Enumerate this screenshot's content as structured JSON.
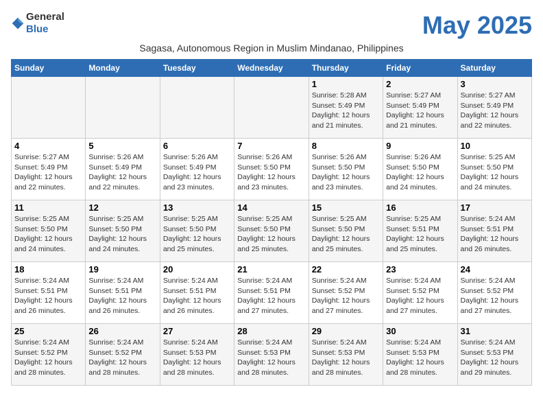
{
  "header": {
    "logo_general": "General",
    "logo_blue": "Blue",
    "month_title": "May 2025",
    "subtitle": "Sagasa, Autonomous Region in Muslim Mindanao, Philippines"
  },
  "days_of_week": [
    "Sunday",
    "Monday",
    "Tuesday",
    "Wednesday",
    "Thursday",
    "Friday",
    "Saturday"
  ],
  "weeks": [
    [
      {
        "day": "",
        "sunrise": "",
        "sunset": "",
        "daylight": ""
      },
      {
        "day": "",
        "sunrise": "",
        "sunset": "",
        "daylight": ""
      },
      {
        "day": "",
        "sunrise": "",
        "sunset": "",
        "daylight": ""
      },
      {
        "day": "",
        "sunrise": "",
        "sunset": "",
        "daylight": ""
      },
      {
        "day": "1",
        "sunrise": "Sunrise: 5:28 AM",
        "sunset": "Sunset: 5:49 PM",
        "daylight": "Daylight: 12 hours and 21 minutes."
      },
      {
        "day": "2",
        "sunrise": "Sunrise: 5:27 AM",
        "sunset": "Sunset: 5:49 PM",
        "daylight": "Daylight: 12 hours and 21 minutes."
      },
      {
        "day": "3",
        "sunrise": "Sunrise: 5:27 AM",
        "sunset": "Sunset: 5:49 PM",
        "daylight": "Daylight: 12 hours and 22 minutes."
      }
    ],
    [
      {
        "day": "4",
        "sunrise": "Sunrise: 5:27 AM",
        "sunset": "Sunset: 5:49 PM",
        "daylight": "Daylight: 12 hours and 22 minutes."
      },
      {
        "day": "5",
        "sunrise": "Sunrise: 5:26 AM",
        "sunset": "Sunset: 5:49 PM",
        "daylight": "Daylight: 12 hours and 22 minutes."
      },
      {
        "day": "6",
        "sunrise": "Sunrise: 5:26 AM",
        "sunset": "Sunset: 5:49 PM",
        "daylight": "Daylight: 12 hours and 23 minutes."
      },
      {
        "day": "7",
        "sunrise": "Sunrise: 5:26 AM",
        "sunset": "Sunset: 5:50 PM",
        "daylight": "Daylight: 12 hours and 23 minutes."
      },
      {
        "day": "8",
        "sunrise": "Sunrise: 5:26 AM",
        "sunset": "Sunset: 5:50 PM",
        "daylight": "Daylight: 12 hours and 23 minutes."
      },
      {
        "day": "9",
        "sunrise": "Sunrise: 5:26 AM",
        "sunset": "Sunset: 5:50 PM",
        "daylight": "Daylight: 12 hours and 24 minutes."
      },
      {
        "day": "10",
        "sunrise": "Sunrise: 5:25 AM",
        "sunset": "Sunset: 5:50 PM",
        "daylight": "Daylight: 12 hours and 24 minutes."
      }
    ],
    [
      {
        "day": "11",
        "sunrise": "Sunrise: 5:25 AM",
        "sunset": "Sunset: 5:50 PM",
        "daylight": "Daylight: 12 hours and 24 minutes."
      },
      {
        "day": "12",
        "sunrise": "Sunrise: 5:25 AM",
        "sunset": "Sunset: 5:50 PM",
        "daylight": "Daylight: 12 hours and 24 minutes."
      },
      {
        "day": "13",
        "sunrise": "Sunrise: 5:25 AM",
        "sunset": "Sunset: 5:50 PM",
        "daylight": "Daylight: 12 hours and 25 minutes."
      },
      {
        "day": "14",
        "sunrise": "Sunrise: 5:25 AM",
        "sunset": "Sunset: 5:50 PM",
        "daylight": "Daylight: 12 hours and 25 minutes."
      },
      {
        "day": "15",
        "sunrise": "Sunrise: 5:25 AM",
        "sunset": "Sunset: 5:50 PM",
        "daylight": "Daylight: 12 hours and 25 minutes."
      },
      {
        "day": "16",
        "sunrise": "Sunrise: 5:25 AM",
        "sunset": "Sunset: 5:51 PM",
        "daylight": "Daylight: 12 hours and 25 minutes."
      },
      {
        "day": "17",
        "sunrise": "Sunrise: 5:24 AM",
        "sunset": "Sunset: 5:51 PM",
        "daylight": "Daylight: 12 hours and 26 minutes."
      }
    ],
    [
      {
        "day": "18",
        "sunrise": "Sunrise: 5:24 AM",
        "sunset": "Sunset: 5:51 PM",
        "daylight": "Daylight: 12 hours and 26 minutes."
      },
      {
        "day": "19",
        "sunrise": "Sunrise: 5:24 AM",
        "sunset": "Sunset: 5:51 PM",
        "daylight": "Daylight: 12 hours and 26 minutes."
      },
      {
        "day": "20",
        "sunrise": "Sunrise: 5:24 AM",
        "sunset": "Sunset: 5:51 PM",
        "daylight": "Daylight: 12 hours and 26 minutes."
      },
      {
        "day": "21",
        "sunrise": "Sunrise: 5:24 AM",
        "sunset": "Sunset: 5:51 PM",
        "daylight": "Daylight: 12 hours and 27 minutes."
      },
      {
        "day": "22",
        "sunrise": "Sunrise: 5:24 AM",
        "sunset": "Sunset: 5:52 PM",
        "daylight": "Daylight: 12 hours and 27 minutes."
      },
      {
        "day": "23",
        "sunrise": "Sunrise: 5:24 AM",
        "sunset": "Sunset: 5:52 PM",
        "daylight": "Daylight: 12 hours and 27 minutes."
      },
      {
        "day": "24",
        "sunrise": "Sunrise: 5:24 AM",
        "sunset": "Sunset: 5:52 PM",
        "daylight": "Daylight: 12 hours and 27 minutes."
      }
    ],
    [
      {
        "day": "25",
        "sunrise": "Sunrise: 5:24 AM",
        "sunset": "Sunset: 5:52 PM",
        "daylight": "Daylight: 12 hours and 28 minutes."
      },
      {
        "day": "26",
        "sunrise": "Sunrise: 5:24 AM",
        "sunset": "Sunset: 5:52 PM",
        "daylight": "Daylight: 12 hours and 28 minutes."
      },
      {
        "day": "27",
        "sunrise": "Sunrise: 5:24 AM",
        "sunset": "Sunset: 5:53 PM",
        "daylight": "Daylight: 12 hours and 28 minutes."
      },
      {
        "day": "28",
        "sunrise": "Sunrise: 5:24 AM",
        "sunset": "Sunset: 5:53 PM",
        "daylight": "Daylight: 12 hours and 28 minutes."
      },
      {
        "day": "29",
        "sunrise": "Sunrise: 5:24 AM",
        "sunset": "Sunset: 5:53 PM",
        "daylight": "Daylight: 12 hours and 28 minutes."
      },
      {
        "day": "30",
        "sunrise": "Sunrise: 5:24 AM",
        "sunset": "Sunset: 5:53 PM",
        "daylight": "Daylight: 12 hours and 28 minutes."
      },
      {
        "day": "31",
        "sunrise": "Sunrise: 5:24 AM",
        "sunset": "Sunset: 5:53 PM",
        "daylight": "Daylight: 12 hours and 29 minutes."
      }
    ]
  ]
}
